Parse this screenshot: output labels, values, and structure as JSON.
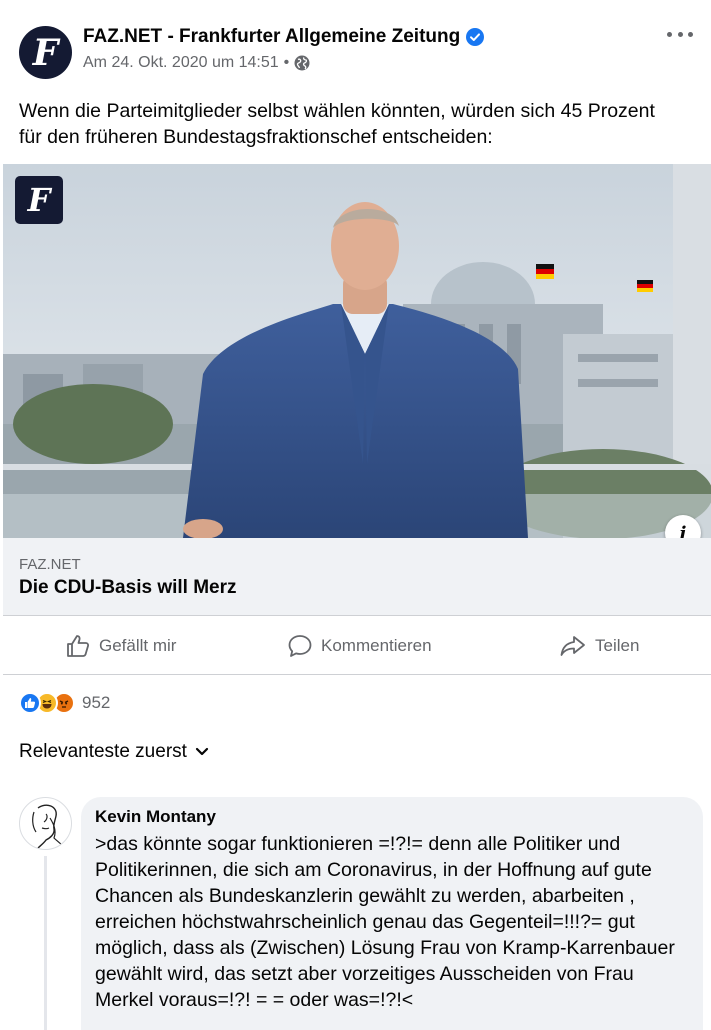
{
  "post": {
    "page_name": "FAZ.NET - Frankfurter Allgemeine Zeitung",
    "avatar_glyph": "F",
    "timestamp": "Am 24. Okt. 2020 um 14:51",
    "separator": "•",
    "audience_icon": "globe-icon",
    "verified_icon": "verified-badge-icon",
    "verified_color": "#1877f2",
    "text": "Wenn die Parteimitglieder selbst wählen könnten, würden sich 45 Prozent für den früheren Bundestagsfraktionschef entscheiden:"
  },
  "link": {
    "logo_glyph": "F",
    "info_glyph": "i",
    "domain": "FAZ.NET",
    "title": "Die CDU-Basis will Merz"
  },
  "actions": {
    "like_label": "Gefällt mir",
    "comment_label": "Kommentieren",
    "share_label": "Teilen"
  },
  "reactions": {
    "types": [
      "like",
      "haha",
      "angry"
    ],
    "count": "952"
  },
  "sort": {
    "label": "Relevanteste zuerst"
  },
  "comment": {
    "author": "Kevin Montany",
    "text": ">das könnte sogar funktionieren =!?!= denn alle  Politiker und Politikerinnen, die sich am Coronavirus, in der Hoffnung auf gute Chancen als Bundeskanzlerin gewählt zu werden, abarbeiten , erreichen höchstwahrscheinlich genau das Gegenteil=!!!?= gut möglich, dass als (Zwischen) Lösung Frau von  Kramp-Karrenbauer gewählt wird, das setzt aber vorzeitiges Ausscheiden von Frau Merkel voraus=!?! = = oder was=!?!<"
  },
  "colors": {
    "text_primary": "#050505",
    "text_secondary": "#65676b",
    "accent_blue": "#1877f2",
    "caption_bg": "#f0f2f5",
    "faz_navy": "#141a33"
  }
}
